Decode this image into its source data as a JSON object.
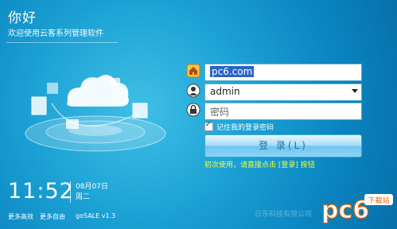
{
  "app": {
    "title": "你好",
    "subtitle": "欢迎使用云客系列管理软件"
  },
  "login": {
    "site_value": "pc6.com",
    "user_value": "admin",
    "password_placeholder": "密码",
    "remember_label": "记住我的登录密码",
    "remember_checked": true,
    "login_button": "登  录(L)",
    "hint": "初次使用，请直接点击 [登录] 按钮"
  },
  "status": {
    "time": "11:52",
    "date": "08月07日",
    "weekday": "周二"
  },
  "footer": {
    "link1": "更多高效",
    "link2": "更多自由",
    "version": "goSALE v1.3"
  },
  "watermark": {
    "logo_text": "pc6",
    "badge": "下载站",
    "faint_text": "日东科技有限公司"
  },
  "icons": {
    "site": "house-icon",
    "user": "user-icon",
    "password": "lock-icon"
  },
  "colors": {
    "background": "#1ea4d6",
    "hint": "#f4ff2f",
    "selection": "#2b63c8"
  }
}
